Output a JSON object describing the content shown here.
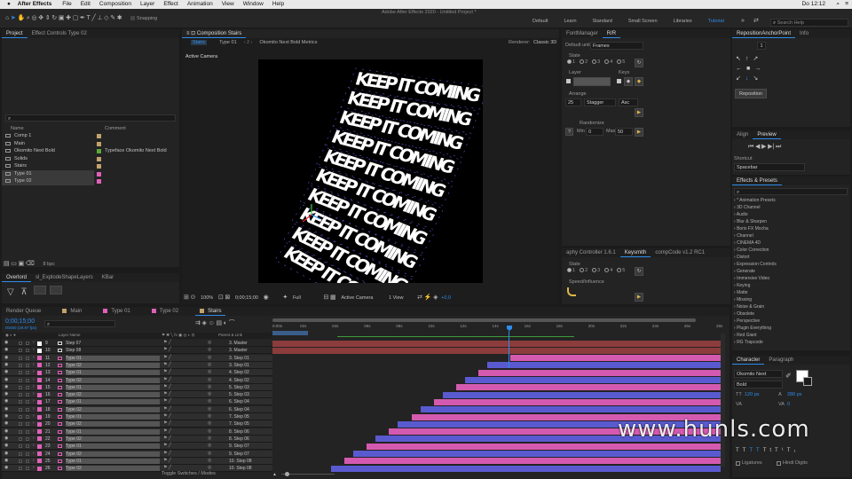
{
  "menubar": {
    "app_name": "After Effects",
    "menus": [
      "File",
      "Edit",
      "Composition",
      "Layer",
      "Effect",
      "Animation",
      "View",
      "Window",
      "Help"
    ],
    "clock": "Do 12:12"
  },
  "toolbar": {
    "snapping_label": "Snapping",
    "window_title": "Adobe After Effects 2020 - Untitled Project *",
    "workspaces": [
      "Default",
      "Learn",
      "Standard",
      "Small Screen",
      "Libraries",
      "Tutorial"
    ],
    "active_workspace": "Tutorial",
    "search_placeholder": "Search Help"
  },
  "project_panel": {
    "tabs": [
      "Project",
      "Effect Controls Type 02"
    ],
    "columns": [
      "Name",
      "Comment"
    ],
    "items": [
      {
        "name": "Comp 1",
        "type": "comp",
        "color": "#c2a26b",
        "comment": ""
      },
      {
        "name": "Main",
        "type": "comp",
        "color": "#c2a26b",
        "comment": ""
      },
      {
        "name": "Okomito Next Bold",
        "type": "comp",
        "color": "#5aa83a",
        "comment": "Typeface Okomito Next Bold"
      },
      {
        "name": "Solids",
        "type": "folder",
        "color": "#c2a26b",
        "comment": ""
      },
      {
        "name": "Stairs",
        "type": "comp",
        "color": "#c2a26b",
        "comment": ""
      },
      {
        "name": "Type 01",
        "type": "comp",
        "color": "#e060b8",
        "comment": ""
      },
      {
        "name": "Type 02",
        "type": "comp",
        "color": "#e060b8",
        "comment": ""
      }
    ],
    "footer_bpc": "8 bpc"
  },
  "overlord_panel": {
    "tabs": [
      "Overlord",
      "sl_ExplodeShapeLayers",
      "KBar"
    ]
  },
  "composition_panel": {
    "title": "Composition Stairs",
    "breadcrumbs": [
      "Stairs",
      "Type 01",
      "Okomito Next Bold Metrics"
    ],
    "renderer_label": "Renderer:",
    "renderer_value": "Classic 3D",
    "view_label": "Active Camera",
    "stair_text": "KEEP IT COMING",
    "footer": {
      "zoom": "100%",
      "timecode": "0;00;15;00",
      "resolution": "Full",
      "camera": "Active Camera",
      "views": "1 View",
      "offset": "+0,0"
    }
  },
  "font_manager_panel": {
    "tabs": [
      "FontManager",
      "R/R"
    ],
    "default_unit_label": "Default unit:",
    "default_unit_value": "Frames",
    "state_label": "State",
    "state_options": [
      "1",
      "2",
      "3",
      "4",
      "5"
    ],
    "layer_label": "Layer",
    "keys_label": "Keys",
    "arrange_label": "Arrange",
    "arrange_value": "25",
    "arrange_mode": "Stagger",
    "arrange_order": "Asc",
    "randomize_label": "Randomize",
    "min_label": "Min",
    "min_value": "0",
    "max_label": "Max",
    "max_value": "50"
  },
  "keysmith_panel": {
    "tabs": [
      "aphy Controller 1.6.1",
      "Keysmith",
      "compCode v1.2 RC1"
    ],
    "state_label": "State",
    "state_options": [
      "1",
      "2",
      "3",
      "4",
      "5"
    ],
    "speed_label": "Speed/Influence"
  },
  "reposition_panel": {
    "tabs": [
      "RepositionAnchorPoint",
      "Info"
    ],
    "count": "1",
    "button": "Reposition"
  },
  "preview_panel": {
    "tabs": [
      "Align",
      "Preview"
    ],
    "shortcut_label": "Shortcut",
    "shortcut_value": "Spacebar"
  },
  "effects_panel": {
    "title": "Effects & Presets",
    "items": [
      "* Animation Presets",
      "3D Channel",
      "Audio",
      "Blur & Sharpen",
      "Boris FX Mocha",
      "Channel",
      "CINEMA 4D",
      "Color Correction",
      "Distort",
      "Expression Controls",
      "Generate",
      "Immersive Video",
      "Keying",
      "Matte",
      "Missing",
      "Noise & Grain",
      "Obsolete",
      "Perspective",
      "Plugin Everything",
      "Red Giant",
      "RG Trapcode"
    ]
  },
  "character_panel": {
    "tabs": [
      "Character",
      "Paragraph"
    ],
    "font": "Okomito Next",
    "style": "Bold",
    "size": "120 px",
    "leading": "280 px",
    "kerning": "0",
    "ligatures": "Ligatures",
    "hindi_digits": "Hindi Digits"
  },
  "timeline": {
    "tabs": [
      "Render Queue",
      "Main",
      "Type 01",
      "Type 02",
      "Stairs"
    ],
    "tab_colors": [
      "",
      "#c2a26b",
      "#e060b8",
      "#e060b8",
      "#c2a26b"
    ],
    "timecode": "0;00;15;00",
    "frame_info": "00450 (29.97 fps)",
    "column_headers": {
      "layer_name": "Layer Name",
      "parent": "Parent & Link"
    },
    "ruler": [
      "0:00s",
      "02s",
      "04s",
      "06s",
      "08s",
      "10s",
      "12s",
      "14s",
      "16s",
      "18s",
      "20s",
      "22s",
      "24s",
      "26s",
      "28s"
    ],
    "layers": [
      {
        "num": "9",
        "name": "Step 07",
        "label": "#ffffff",
        "parent": "3. Master",
        "bar": "#8c3c3c",
        "start": 0.0
      },
      {
        "num": "10",
        "name": "Step 08",
        "label": "#ffffff",
        "parent": "3. Master",
        "bar": "#8c3c3c",
        "start": 0.0
      },
      {
        "num": "11",
        "name": "Type 01",
        "label": "#e060b8",
        "parent": "3. Step 01",
        "bar": "#d45ab0",
        "start": 0.53
      },
      {
        "num": "12",
        "name": "Type 02",
        "label": "#e060b8",
        "parent": "3. Step 01",
        "bar": "#5a5ad0",
        "start": 0.48
      },
      {
        "num": "13",
        "name": "Type 01",
        "label": "#e060b8",
        "parent": "4. Step 02",
        "bar": "#d45ab0",
        "start": 0.46
      },
      {
        "num": "14",
        "name": "Type 02",
        "label": "#e060b8",
        "parent": "4. Step 02",
        "bar": "#5a5ad0",
        "start": 0.43
      },
      {
        "num": "15",
        "name": "Type 01",
        "label": "#e060b8",
        "parent": "5. Step 03",
        "bar": "#d45ab0",
        "start": 0.41
      },
      {
        "num": "16",
        "name": "Type 02",
        "label": "#e060b8",
        "parent": "5. Step 03",
        "bar": "#5a5ad0",
        "start": 0.38
      },
      {
        "num": "17",
        "name": "Type 01",
        "label": "#e060b8",
        "parent": "6. Step 04",
        "bar": "#d45ab0",
        "start": 0.36
      },
      {
        "num": "18",
        "name": "Type 02",
        "label": "#e060b8",
        "parent": "6. Step 04",
        "bar": "#5a5ad0",
        "start": 0.33
      },
      {
        "num": "19",
        "name": "Type 01",
        "label": "#e060b8",
        "parent": "7. Step 05",
        "bar": "#d45ab0",
        "start": 0.31
      },
      {
        "num": "20",
        "name": "Type 02",
        "label": "#e060b8",
        "parent": "7. Step 05",
        "bar": "#5a5ad0",
        "start": 0.28
      },
      {
        "num": "21",
        "name": "Type 01",
        "label": "#e060b8",
        "parent": "8. Step 06",
        "bar": "#d45ab0",
        "start": 0.26
      },
      {
        "num": "22",
        "name": "Type 02",
        "label": "#e060b8",
        "parent": "8. Step 06",
        "bar": "#5a5ad0",
        "start": 0.23
      },
      {
        "num": "23",
        "name": "Type 01",
        "label": "#e060b8",
        "parent": "9. Step 07",
        "bar": "#d45ab0",
        "start": 0.21
      },
      {
        "num": "24",
        "name": "Type 02",
        "label": "#e060b8",
        "parent": "9. Step 07",
        "bar": "#5a5ad0",
        "start": 0.18
      },
      {
        "num": "25",
        "name": "Type 01",
        "label": "#e060b8",
        "parent": "10. Step 08",
        "bar": "#d45ab0",
        "start": 0.16
      },
      {
        "num": "26",
        "name": "Type 02",
        "label": "#e060b8",
        "parent": "10. Step 08",
        "bar": "#5a5ad0",
        "start": 0.13
      }
    ],
    "footer": "Toggle Switches / Modes"
  },
  "watermark": "www.hunls.com",
  "colors": {
    "accent": "#2d8ceb",
    "pink": "#e060b8",
    "purple": "#5a5ad0",
    "tan": "#c2a26b"
  }
}
